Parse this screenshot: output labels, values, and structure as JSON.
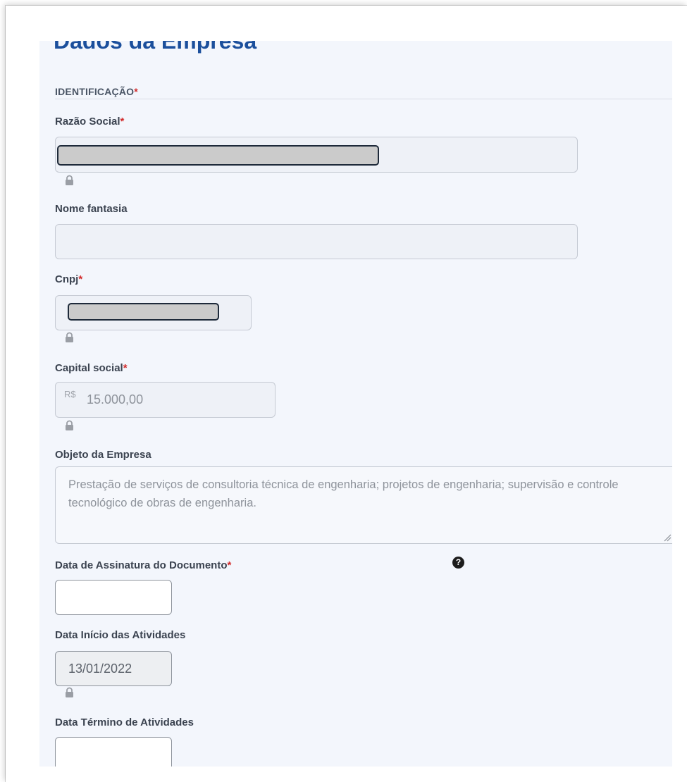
{
  "page": {
    "title": "Dados da Empresa"
  },
  "section": {
    "label": "IDENTIFICAÇÃO",
    "required_mark": "*"
  },
  "fields": {
    "razao_social": {
      "label": "Razão Social",
      "required_mark": "*",
      "value": "",
      "locked": true
    },
    "nome_fantasia": {
      "label": "Nome fantasia",
      "value": ""
    },
    "cnpj": {
      "label": "Cnpj",
      "required_mark": "*",
      "value": "",
      "locked": true
    },
    "capital_social": {
      "label": "Capital social",
      "required_mark": "*",
      "prefix": "R$",
      "value": "15.000,00",
      "locked": true
    },
    "objeto_empresa": {
      "label": "Objeto da Empresa",
      "value": "Prestação de serviços de consultoria técnica de engenharia; projetos de engenharia; supervisão e controle  tecnológico de obras de engenharia."
    },
    "data_assinatura": {
      "label": "Data de Assinatura do Documento",
      "required_mark": "*",
      "value": "",
      "help_icon": "question-circle-icon"
    },
    "data_inicio": {
      "label": "Data Início das Atividades",
      "value": "13/01/2022",
      "locked": true
    },
    "data_termino": {
      "label": "Data Término de Atividades",
      "value": ""
    }
  },
  "icons": {
    "lock": "lock-icon",
    "help": "question-circle-icon"
  },
  "colors": {
    "title": "#1b4f9c",
    "required": "#d22b2b",
    "panel_bg": "#f3f6fc"
  }
}
